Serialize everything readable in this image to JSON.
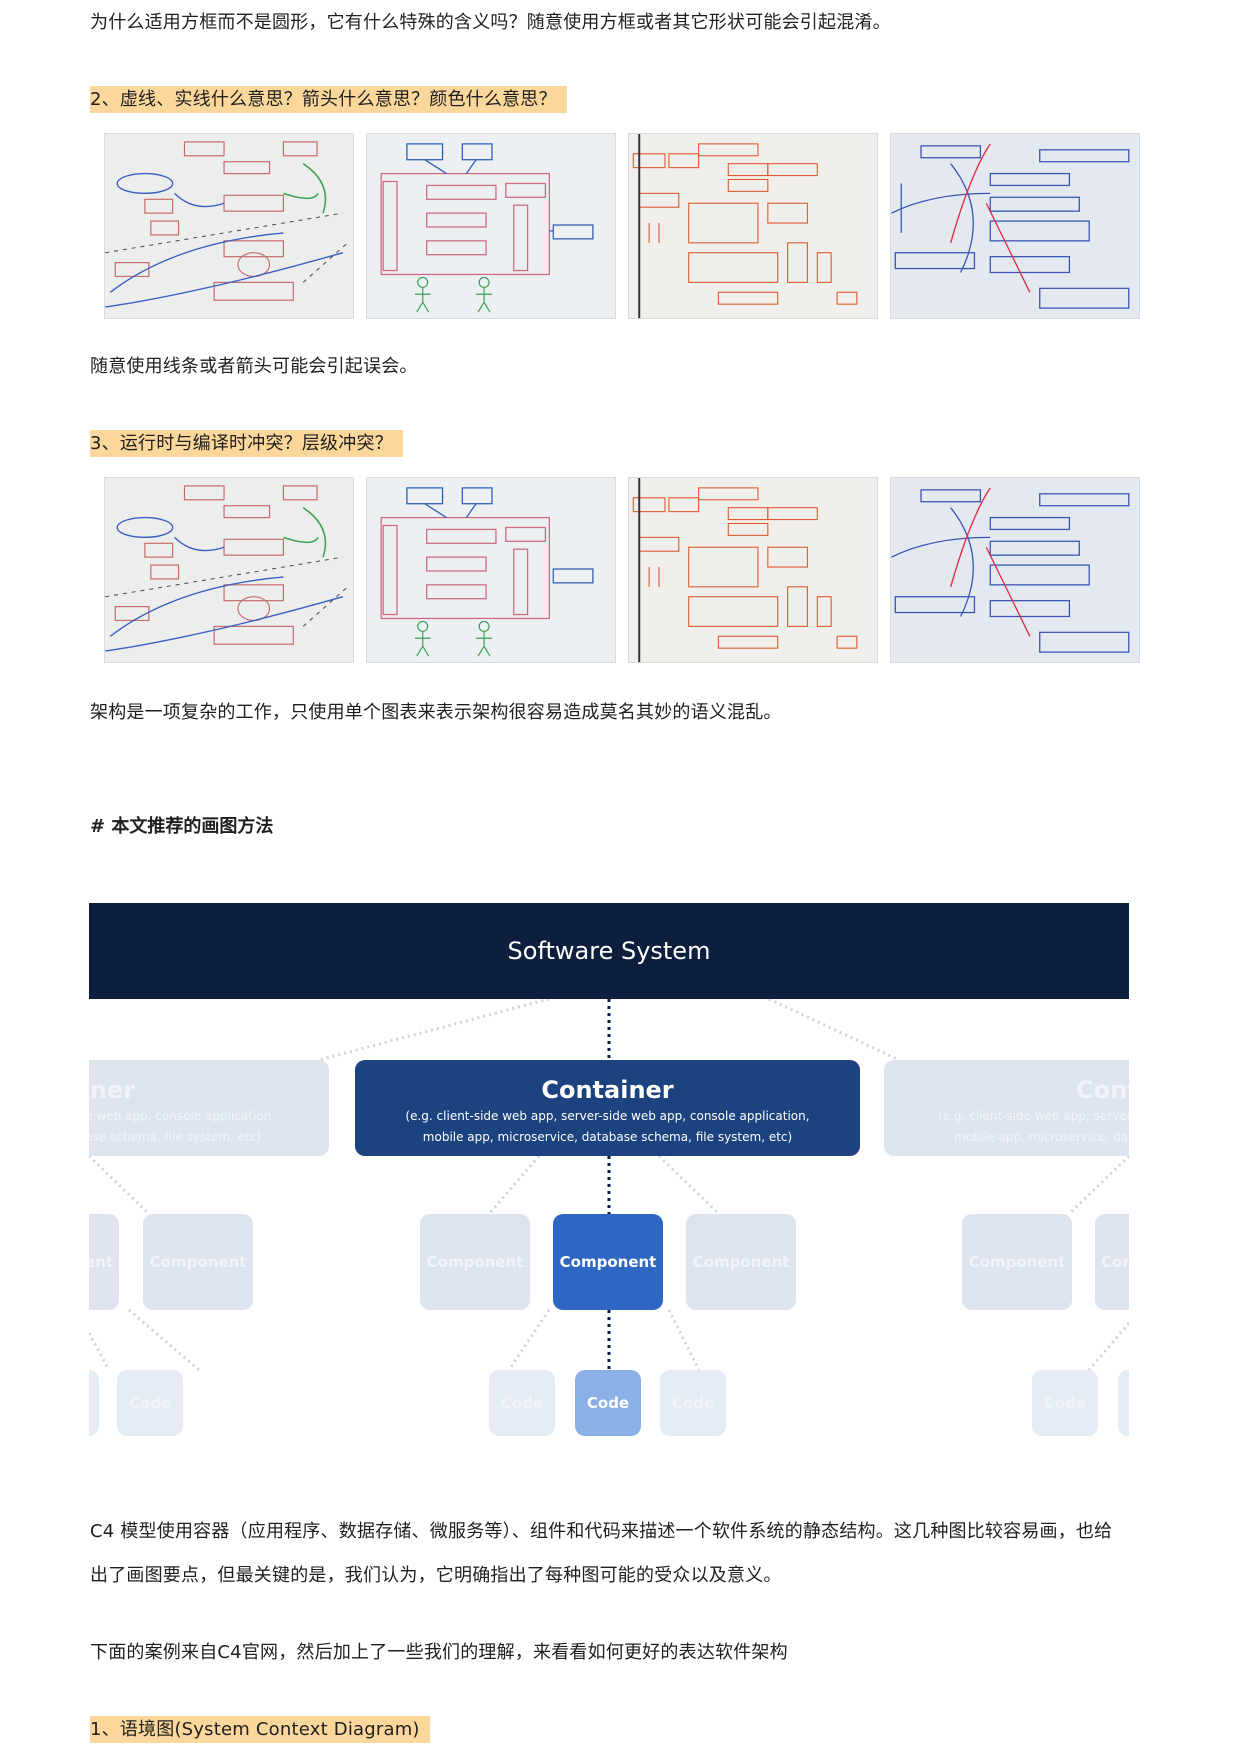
{
  "paragraphs": {
    "p1": "为什么适用方框而不是圆形，它有什么特殊的含义吗？随意使用方框或者其它形状可能会引起混淆。",
    "h2": "2、虚线、实线什么意思？箭头什么意思？颜色什么意思？",
    "p2": "随意使用线条或者箭头可能会引起误会。",
    "h3": "3、运行时与编译时冲突？层级冲突？",
    "p3": "架构是一项复杂的工作，只使用单个图表来表示架构很容易造成莫名其妙的语义混乱。",
    "section": "# 本文推荐的画图方法",
    "p4a": "C4 模型使用容器（应用程序、数据存储、微服务等）、组件和代码来描述一个软件系统的静态结构。这几种图比较容易画，也给",
    "p4b": "出了画图要点，但最关键的是，我们认为，它明确指出了每种图可能的受众以及意义。",
    "p5": "下面的案例来自C4官网，然后加上了一些我们的理解，来看看如何更好的表达软件架构",
    "h4": "1、语境图(System Context Diagram)"
  },
  "c4": {
    "software_system": "Software System",
    "container_title": "Container",
    "container_desc_1": "(e.g. client-side web app, server-side web app, console application,",
    "container_desc_2": "mobile app, microservice, database schema, file system, etc)",
    "left_container_title": "iner",
    "left_desc_1": "e web app, console application,",
    "left_desc_2": "ase schema, file system, etc)",
    "right_container_title": "Cont",
    "right_desc_1": "(e.g. client-side web app, server-",
    "right_desc_2": "mobile app, microservice, da",
    "component": "Component",
    "component_partial_left": "ent",
    "component_partial_right": "Cor",
    "code": "Code"
  },
  "colors": {
    "highlight": "#fbd79b",
    "system": "#0d1f3c",
    "container": "#1c4380",
    "component": "#2e66c4",
    "code": "#8bb0e8",
    "faded": "#dde4ef"
  }
}
